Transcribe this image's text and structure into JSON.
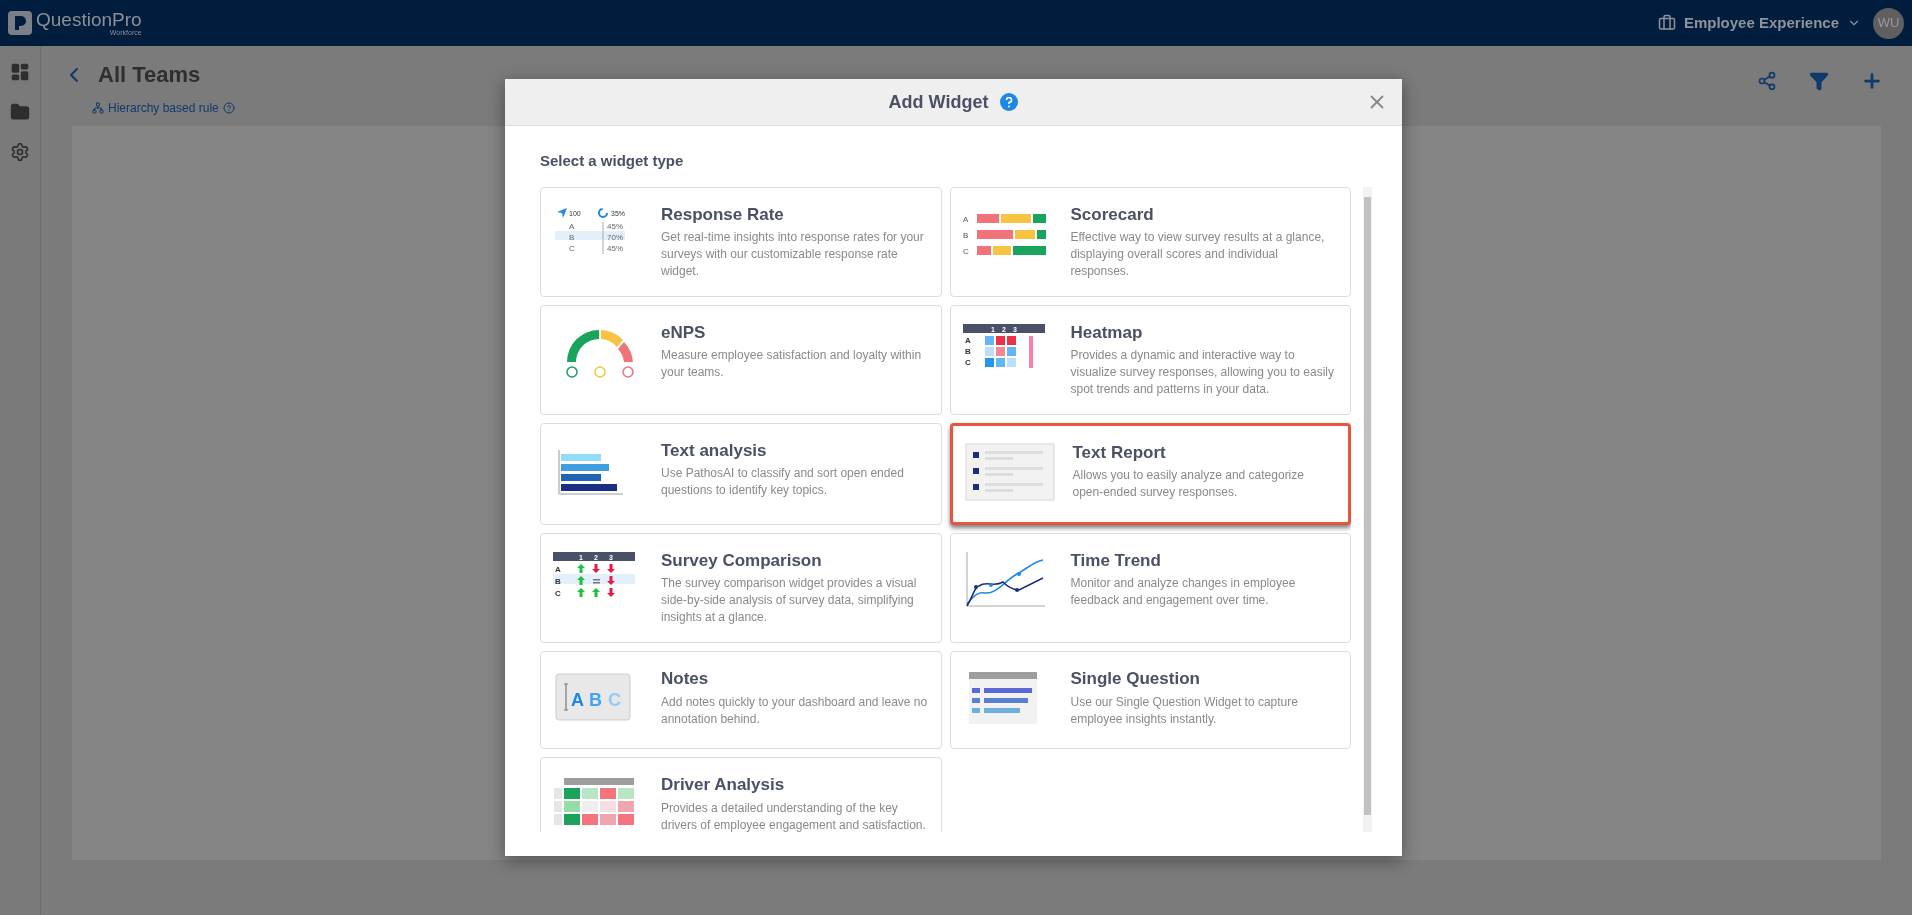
{
  "topbar": {
    "logo_name": "QuestionPro",
    "logo_sub": "Workforce",
    "product": "Employee Experience",
    "avatar": "WU"
  },
  "page": {
    "title": "All Teams",
    "rule": "Hierarchy based rule"
  },
  "dialog": {
    "title": "Add Widget",
    "subtitle": "Select a widget type",
    "widgets": [
      {
        "kind": "response_rate",
        "title": "Response Rate",
        "description": "Get real-time insights into response rates for your surveys with our customizable response rate widget.",
        "selected": false,
        "thumbnail_text": [
          "100",
          "35%",
          "A",
          "45%",
          "B",
          "70%",
          "C",
          "45%"
        ]
      },
      {
        "kind": "scorecard",
        "title": "Scorecard",
        "description": "Effective way to view survey results at a glance, displaying overall scores and individual responses.",
        "selected": false,
        "thumbnail_text": [
          "A",
          "B",
          "C"
        ]
      },
      {
        "kind": "enps",
        "title": "eNPS",
        "description": "Measure employee satisfaction and loyalty within your teams.",
        "selected": false
      },
      {
        "kind": "heatmap",
        "title": "Heatmap",
        "description": "Provides a dynamic and interactive way to visualize survey responses, allowing you to easily spot trends and patterns in your data.",
        "selected": false,
        "thumbnail_text": [
          "1",
          "2",
          "3",
          "A",
          "B",
          "C"
        ]
      },
      {
        "kind": "text_analysis",
        "title": "Text analysis",
        "description": "Use PathosAI to classify and sort open ended questions to identify key topics.",
        "selected": false
      },
      {
        "kind": "text_report",
        "title": "Text Report",
        "description": "Allows you to easily analyze and categorize open-ended survey responses.",
        "selected": true
      },
      {
        "kind": "survey_comparison",
        "title": "Survey Comparison",
        "description": "The survey comparison widget provides a visual side-by-side analysis of survey data, simplifying insights at a glance.",
        "selected": false,
        "thumbnail_text": [
          "1",
          "2",
          "3",
          "A",
          "B",
          "C"
        ]
      },
      {
        "kind": "time_trend",
        "title": "Time Trend",
        "description": "Monitor and analyze changes in employee feedback and engagement over time.",
        "selected": false
      },
      {
        "kind": "notes",
        "title": "Notes",
        "description": "Add notes quickly to your dashboard and leave no annotation behind.",
        "selected": false,
        "thumbnail_text": [
          "A",
          "B",
          "C"
        ]
      },
      {
        "kind": "single_question",
        "title": "Single Question",
        "description": "Use our Single Question Widget to capture employee insights instantly.",
        "selected": false
      },
      {
        "kind": "driver_analysis",
        "title": "Driver Analysis",
        "description": "Provides a detailed understanding of the key drivers of employee engagement and satisfaction.",
        "selected": false
      }
    ]
  }
}
